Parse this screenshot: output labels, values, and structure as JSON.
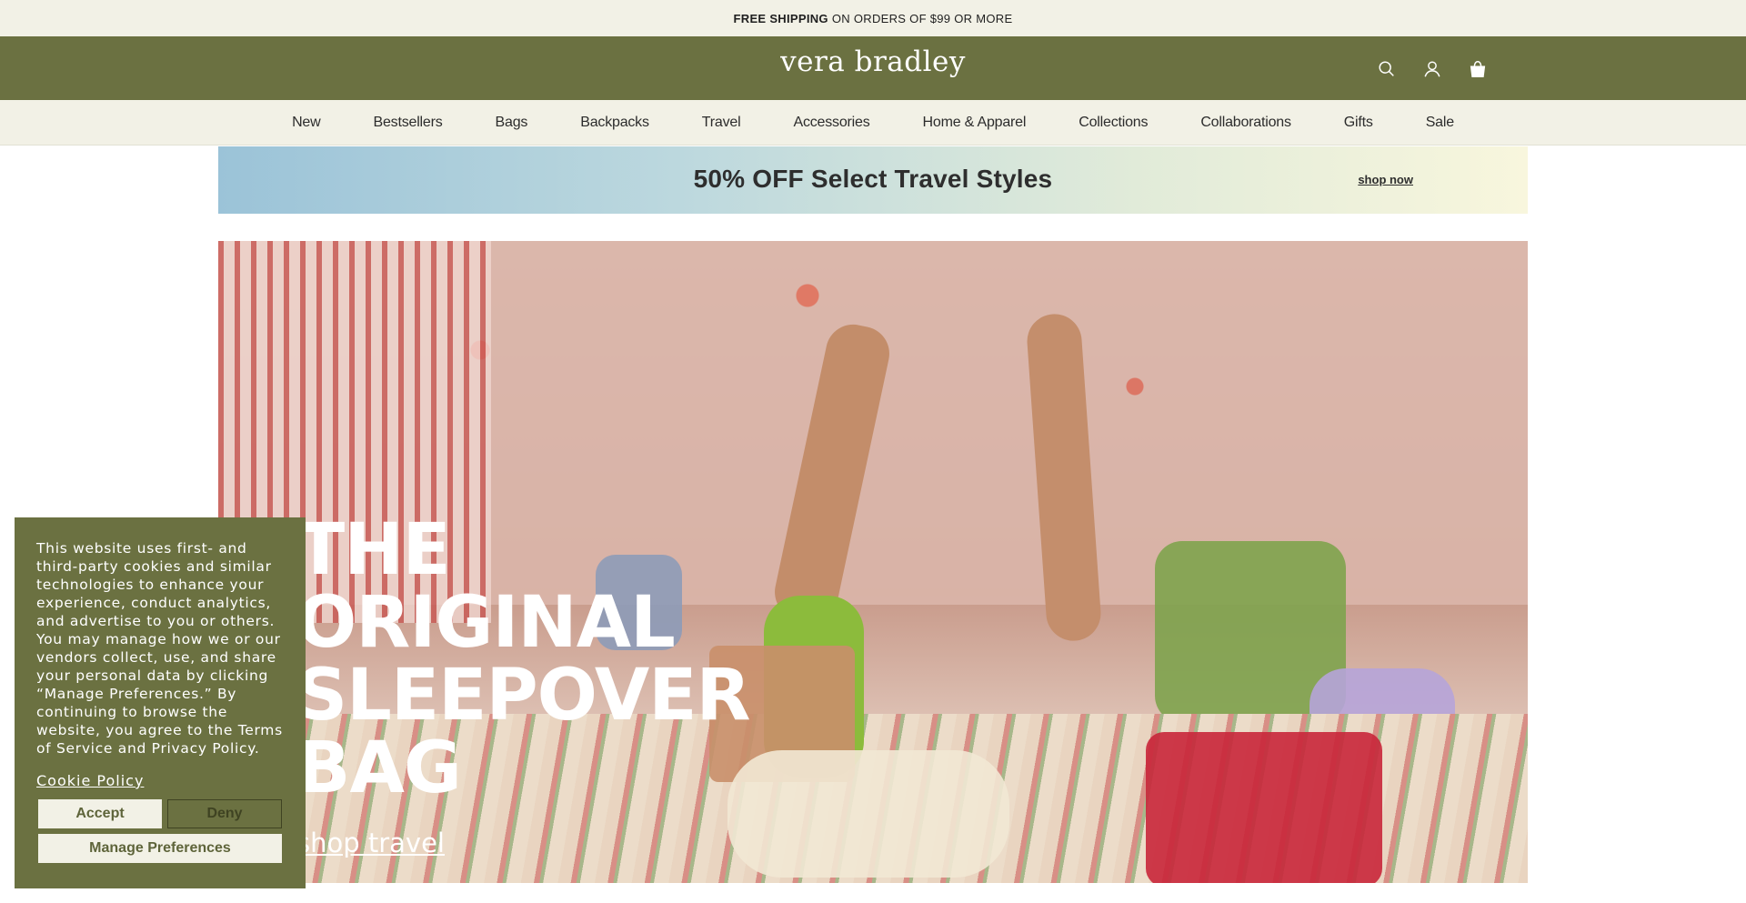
{
  "topbar": {
    "bold": "FREE SHIPPING",
    "rest": "ON ORDERS OF $99 OR MORE"
  },
  "header": {
    "logo": "vera bradley",
    "icons": [
      "search-icon",
      "account-icon",
      "bag-icon"
    ],
    "brand_color": "#6b7141"
  },
  "nav": {
    "items": [
      "New",
      "Bestsellers",
      "Bags",
      "Backpacks",
      "Travel",
      "Accessories",
      "Home & Apparel",
      "Collections",
      "Collaborations",
      "Gifts",
      "Sale"
    ]
  },
  "promo": {
    "title": "50% OFF Select Travel Styles",
    "link": "shop now"
  },
  "hero": {
    "title_lines": [
      "THE",
      "ORIGINAL",
      "SLEEPOVER",
      "BAG"
    ],
    "link": "shop travel"
  },
  "cookie": {
    "text": "This website uses first- and third-party cookies and similar technologies to enhance your experience, conduct analytics, and advertise to you or others. You may manage how we or our vendors collect, use, and share your personal data by clicking “Manage Preferences.” By continuing to browse the website, you agree to the Terms of Service and Privacy Policy.",
    "policy_link": "Cookie Policy",
    "accept": "Accept",
    "deny": "Deny",
    "manage": "Manage Preferences"
  }
}
